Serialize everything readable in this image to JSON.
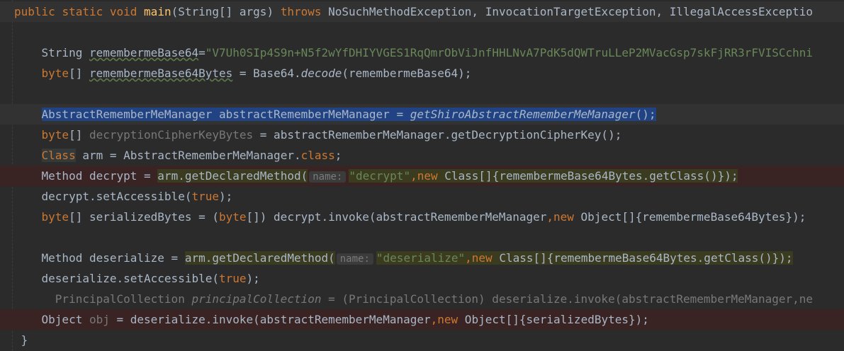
{
  "editor": {
    "lines": [
      {
        "type": "current",
        "segs": [
          {
            "t": "public",
            "c": "kw"
          },
          {
            "t": " "
          },
          {
            "t": "static",
            "c": "kw"
          },
          {
            "t": " "
          },
          {
            "t": "void",
            "c": "kw"
          },
          {
            "t": " "
          },
          {
            "t": "main",
            "c": "fn"
          },
          {
            "t": "(String[] args) "
          },
          {
            "t": "throws",
            "c": "kw"
          },
          {
            "t": " NoSuchMethodException, InvocationTargetException, IllegalAccessExceptio"
          }
        ]
      },
      {
        "segs": []
      },
      {
        "segs": [
          {
            "t": "    String "
          },
          {
            "t": "remembermeBase64",
            "c": "uline"
          },
          {
            "t": "="
          },
          {
            "t": "\"V7Uh0SIp4S9n+N5f2wYfDHIYVGES1RqQmrObViJnfHHLNvA7PdK5dQWTruLLeP2MVacGsp7skFjRR3rFVISCchni",
            "c": "str"
          }
        ]
      },
      {
        "segs": [
          {
            "t": "    "
          },
          {
            "t": "byte",
            "c": "kw"
          },
          {
            "t": "[] "
          },
          {
            "t": "remembermeBase64Bytes",
            "c": "uline"
          },
          {
            "t": " = Base64."
          },
          {
            "t": "decode",
            "c": "ital"
          },
          {
            "t": "(remembermeBase64);"
          }
        ]
      },
      {
        "segs": []
      },
      {
        "type": "current",
        "segs": [
          {
            "t": "    "
          },
          {
            "t": "AbstractRememberMeManager abstractRememberMeManager = ",
            "c": "sel"
          },
          {
            "t": "getShiroAbstractRememberMeManager",
            "c": "sel ital"
          },
          {
            "t": "();",
            "c": "sel"
          }
        ]
      },
      {
        "segs": [
          {
            "t": "    "
          },
          {
            "t": "byte",
            "c": "kw"
          },
          {
            "t": "[] "
          },
          {
            "t": "decryptionCipherKeyBytes",
            "c": "unused"
          },
          {
            "t": " = abstractRememberMeManager.getDecryptionCipherKey();"
          }
        ]
      },
      {
        "segs": [
          {
            "t": "    "
          },
          {
            "t": "Class",
            "c": "kw cls"
          },
          {
            "t": " arm = AbstractRememberMeManager."
          },
          {
            "t": "class",
            "c": "kw"
          },
          {
            "t": ";"
          }
        ]
      },
      {
        "type": "bp",
        "segs": [
          {
            "t": "    Method decrypt = "
          },
          {
            "t": "arm.getDeclaredMethod(",
            "c": "hl"
          },
          {
            "t": "name:",
            "c": "hint"
          },
          {
            "t": "\"decrypt\"",
            "c": "str hl"
          },
          {
            "t": ",",
            "c": "kw hl"
          },
          {
            "t": "new",
            "c": "kw hl"
          },
          {
            "t": " Class[]{remembermeBase64Bytes.getClass()}",
            "c": "hl"
          },
          {
            "t": ");",
            "c": "hl"
          }
        ]
      },
      {
        "segs": [
          {
            "t": "    decrypt.setAccessible("
          },
          {
            "t": "true",
            "c": "kw"
          },
          {
            "t": ");"
          }
        ]
      },
      {
        "segs": [
          {
            "t": "    "
          },
          {
            "t": "byte",
            "c": "kw"
          },
          {
            "t": "[] serializedBytes = ("
          },
          {
            "t": "byte",
            "c": "kw"
          },
          {
            "t": "[]) decrypt.invoke(abstractRememberMeManager"
          },
          {
            "t": ",",
            "c": "kw"
          },
          {
            "t": "new",
            "c": "kw"
          },
          {
            "t": " Object[]{remembermeBase64Bytes});"
          }
        ]
      },
      {
        "segs": []
      },
      {
        "segs": [
          {
            "t": "    Method deserialize = "
          },
          {
            "t": "arm.getDeclaredMethod(",
            "c": "hl"
          },
          {
            "t": "name:",
            "c": "hint"
          },
          {
            "t": "\"deserialize\"",
            "c": "str hl"
          },
          {
            "t": ",",
            "c": "kw hl"
          },
          {
            "t": "new",
            "c": "kw hl"
          },
          {
            "t": " Class[]{remembermeBase64Bytes.getClass()}",
            "c": "hl"
          },
          {
            "t": ");",
            "c": "hl"
          }
        ]
      },
      {
        "segs": [
          {
            "t": "    deserialize.setAccessible("
          },
          {
            "t": "true",
            "c": "kw"
          },
          {
            "t": ");"
          }
        ]
      },
      {
        "segs": [
          {
            "t": "      PrincipalCollection ",
            "c": "unused"
          },
          {
            "t": "principalCollection",
            "c": "unused ital"
          },
          {
            "t": " = (PrincipalCollection) deserialize.invoke(abstractRememberMeManager,ne",
            "c": "unused"
          }
        ]
      },
      {
        "type": "bp",
        "segs": [
          {
            "t": "    Object "
          },
          {
            "t": "obj",
            "c": "unused"
          },
          {
            "t": " = deserialize.invoke(abstractRememberMeManager"
          },
          {
            "t": ",",
            "c": "kw"
          },
          {
            "t": "new",
            "c": "kw"
          },
          {
            "t": " Object[]{serializedBytes});"
          }
        ]
      },
      {
        "segs": [
          {
            "t": " }"
          }
        ]
      }
    ]
  }
}
